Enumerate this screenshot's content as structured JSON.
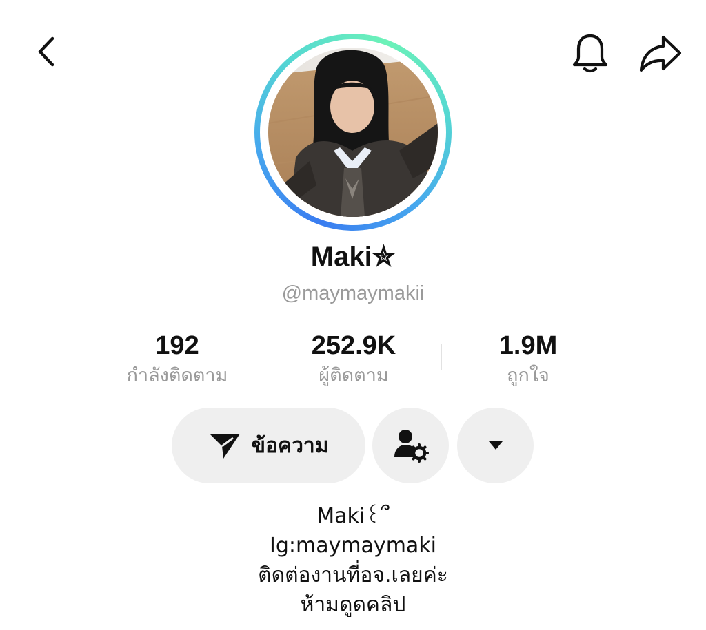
{
  "header": {
    "back_icon": "chevron-left-icon",
    "bell_icon": "bell-icon",
    "share_icon": "share-arrow-icon"
  },
  "profile": {
    "avatar": "avatar-photo",
    "ring_colors": [
      "#3a7cf0",
      "#6cf2b8"
    ],
    "display_name": "Maki✮",
    "username": "@maymaymakii"
  },
  "stats": [
    {
      "value": "192",
      "label": "กำลังติดตาม"
    },
    {
      "value": "252.9K",
      "label": "ผู้ติดตาม"
    },
    {
      "value": "1.9M",
      "label": "ถูกใจ"
    }
  ],
  "actions": {
    "message_label": "ข้อความ",
    "message_icon": "send-icon",
    "friend_icon": "user-settings-icon",
    "more_icon": "caret-down-icon"
  },
  "bio": {
    "lines": [
      "Maki꒰՞",
      "Ig:maymaymaki",
      "ติดต่องานที่อจ.เลยค่ะ",
      "ห้ามดูดคลิป"
    ]
  }
}
